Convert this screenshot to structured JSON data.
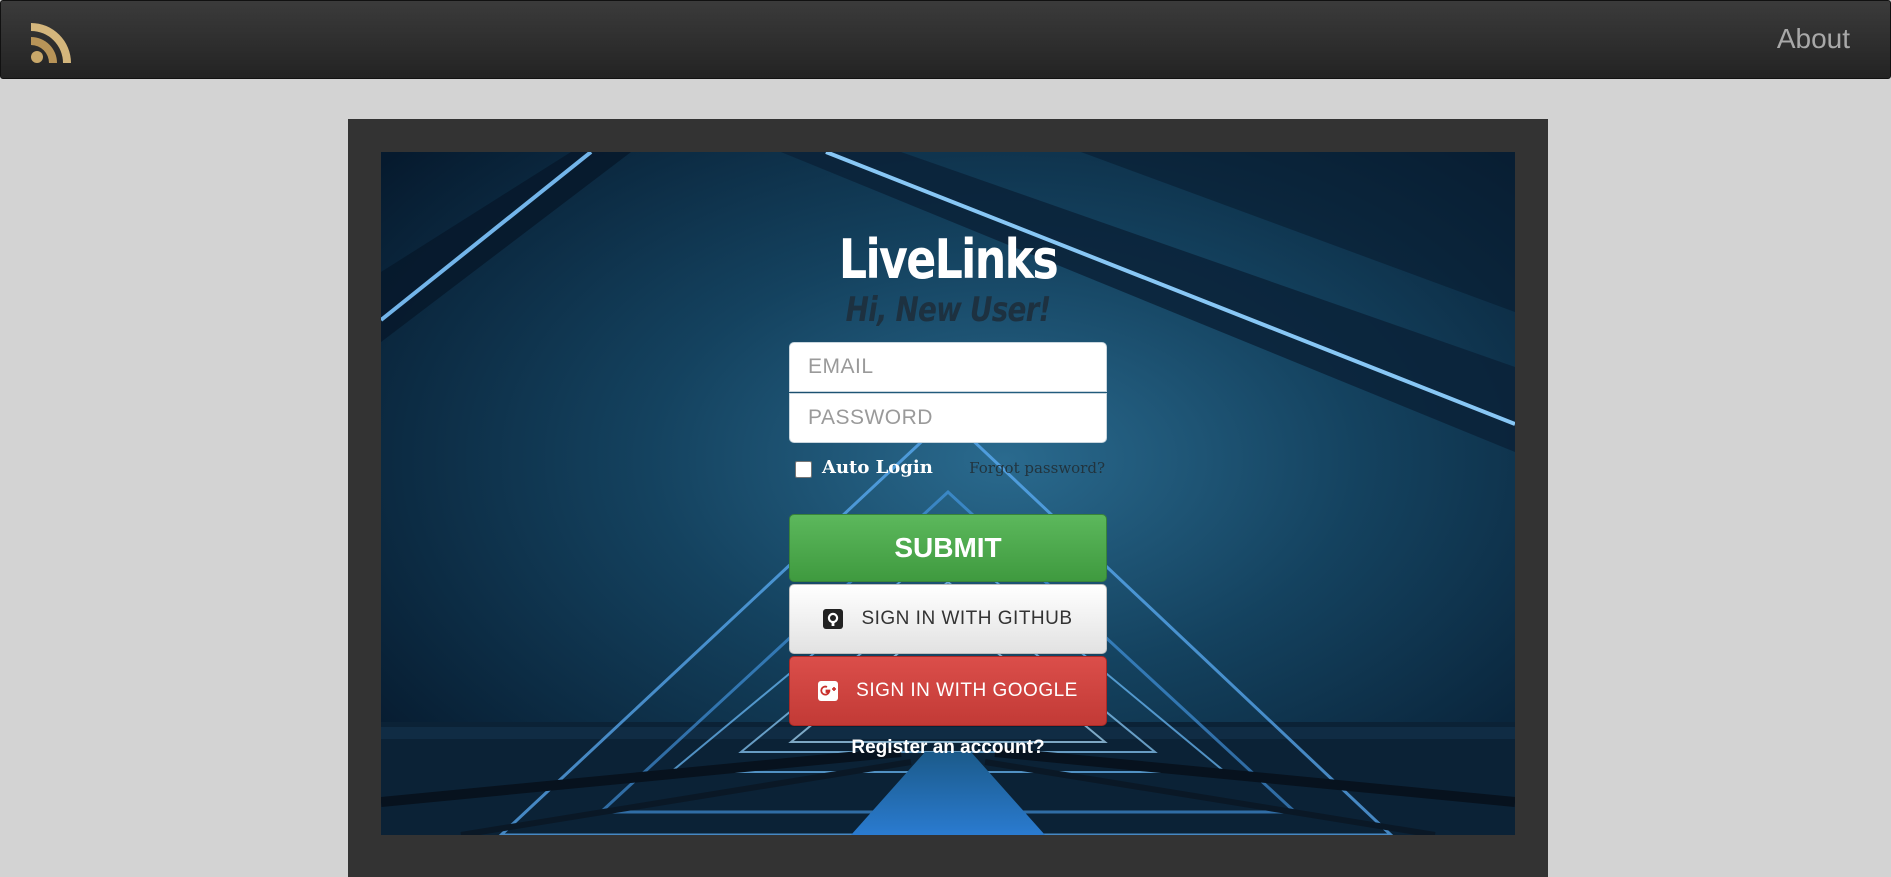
{
  "navbar": {
    "logo_icon": "rss-feed-logo-icon",
    "about_label": "About"
  },
  "form": {
    "title": "LiveLinks",
    "greeting": "Hi, New User!",
    "email_placeholder": "EMAIL",
    "email_value": "",
    "password_placeholder": "PASSWORD",
    "password_value": "",
    "auto_login_label": "Auto Login",
    "auto_login_checked": false,
    "forgot_label": "Forgot password?",
    "submit_label": "SUBMIT",
    "github_label": "SIGN IN WITH GITHUB",
    "github_icon": "github-icon",
    "google_label": "SIGN IN WITH GOOGLE",
    "google_icon": "google-plus-icon",
    "register_label": "Register an account?"
  },
  "colors": {
    "submit": "#5cb85c",
    "google": "#d9534f",
    "navbar": "#2c2c2c",
    "frame": "#333333",
    "page": "#d3d3d3"
  }
}
